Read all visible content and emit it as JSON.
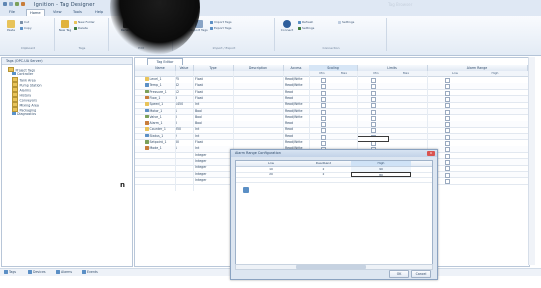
{
  "app": {
    "title": "Ignition - Tag Designer",
    "window_hint": "Tag Browser"
  },
  "ribbon": {
    "tabs": [
      "File",
      "Home",
      "View",
      "Tools",
      "Help"
    ],
    "active_tab": "Home",
    "groups": [
      {
        "label": "Clipboard",
        "buttons": [
          "Paste",
          "Cut",
          "Copy"
        ]
      },
      {
        "label": "Tags",
        "buttons": [
          "New Tag",
          "New Folder",
          "Delete"
        ]
      },
      {
        "label": "Edit",
        "buttons": [
          "Rename",
          "Properties"
        ]
      },
      {
        "label": "Import / Export",
        "buttons": [
          "Import Tags",
          "Export Tags"
        ]
      },
      {
        "label": "Connection",
        "buttons": [
          "Connect",
          "Refresh",
          "Settings"
        ]
      }
    ]
  },
  "tree": {
    "root_label": "Tags (OPC-UA Server)",
    "nodes": [
      "Project Tags",
      "Controller",
      "Tank Area",
      "Pump Station",
      "Alarms",
      "History",
      "Conveyors",
      "Mixing Area",
      "Packaging",
      "Diagnostics"
    ]
  },
  "grid": {
    "doc_tab": "Tag Editor",
    "columns": [
      "Name",
      "Value",
      "Type",
      "Description",
      "Access",
      "Scaling",
      "Limits",
      "Alarm Range"
    ],
    "subcolumns": [
      "Min",
      "Max",
      "Min",
      "Max",
      "Low",
      "High"
    ],
    "rows": [
      {
        "name": "Level_1",
        "value": "75",
        "type": "Float",
        "access": "Read/Write"
      },
      {
        "name": "Temp_1",
        "value": "42",
        "type": "Float",
        "access": "Read/Write"
      },
      {
        "name": "Pressure_1",
        "value": "12",
        "type": "Float",
        "access": "Read"
      },
      {
        "name": "Flow_1",
        "value": "8",
        "type": "Float",
        "access": "Read"
      },
      {
        "name": "Speed_1",
        "value": "1450",
        "type": "Int",
        "access": "Read/Write"
      },
      {
        "name": "Motor_1",
        "value": "1",
        "type": "Bool",
        "access": "Read/Write"
      },
      {
        "name": "Valve_1",
        "value": "0",
        "type": "Bool",
        "access": "Read/Write"
      },
      {
        "name": "Alarm_1",
        "value": "0",
        "type": "Bool",
        "access": "Read"
      },
      {
        "name": "Counter_1",
        "value": "350",
        "type": "Int",
        "access": "Read"
      },
      {
        "name": "Status_1",
        "value": "2",
        "type": "Int",
        "access": "Read"
      },
      {
        "name": "Setpoint_1",
        "value": "60",
        "type": "Float",
        "access": "Read/Write"
      },
      {
        "name": "Mode_1",
        "value": "1",
        "type": "Int",
        "access": "Read/Write"
      },
      {
        "name": "",
        "value": "",
        "type": "Integer",
        "access": ""
      },
      {
        "name": "",
        "value": "",
        "type": "Integer",
        "access": ""
      },
      {
        "name": "",
        "value": "",
        "type": "Integer",
        "access": ""
      },
      {
        "name": "",
        "value": "",
        "type": "Integer",
        "access": ""
      },
      {
        "name": "",
        "value": "",
        "type": "Integer",
        "access": ""
      }
    ]
  },
  "dialog": {
    "title": "Alarm Range Configuration",
    "close_label": "x",
    "headers": [
      "Low",
      "Deadband",
      "High"
    ],
    "rows": [
      [
        "10",
        "2",
        "90"
      ],
      [
        "20",
        "2",
        "80"
      ],
      [
        "",
        "",
        ""
      ]
    ],
    "buttons": [
      "OK",
      "Cancel"
    ]
  },
  "statusbar": {
    "items": [
      "Tags",
      "Devices",
      "Alarms",
      "Events"
    ]
  },
  "colors": {
    "accent": "#5b8fc5",
    "obstruction": "#111111"
  }
}
